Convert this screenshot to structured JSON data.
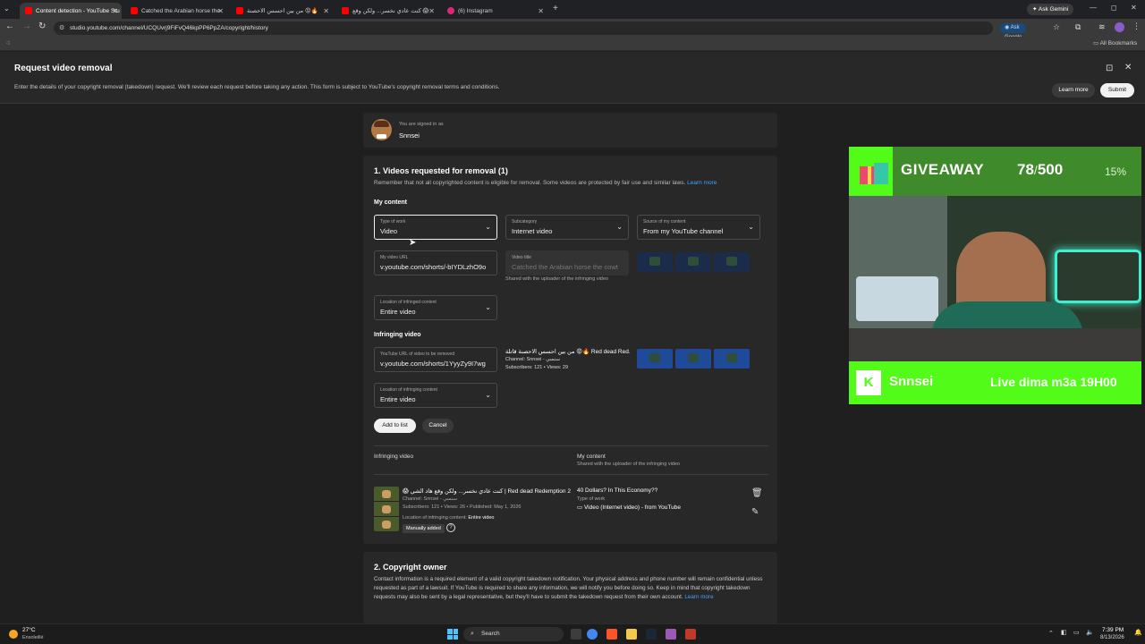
{
  "browser": {
    "tabs": [
      {
        "label": "Content detection - YouTube Stu",
        "color": "#ff0000"
      },
      {
        "label": "Catched the Arabian horse the",
        "color": "#ff0000"
      },
      {
        "label": "من بين احسس الاحصنة 😡🔥",
        "color": "#ff0000"
      },
      {
        "label": "كنت عادي نخسر... ولكن وقع 😱",
        "color": "#ff0000"
      },
      {
        "label": "(6) Instagram",
        "color": "#d62976"
      }
    ],
    "new_tab": "+",
    "ask_gemini": "Ask Gemini",
    "url": "studio.youtube.com/channel/UCQUvrj9FiFvQ46kpPP6PpZA/copyright/history",
    "ask_google": "Ask Google",
    "all_bookmarks": "All Bookmarks"
  },
  "header": {
    "title": "Request video removal",
    "description": "Enter the details of your copyright removal (takedown) request. We'll review each request before taking any action. This form is subject to YouTube's copyright removal terms and conditions.",
    "learn_more": "Learn more",
    "submit": "Submit"
  },
  "signed_in": {
    "label": "You are signed in as",
    "name": "Snnsei"
  },
  "section1": {
    "title": "1. Videos requested for removal (1)",
    "note": "Remember that not all copyrighted content is eligible for removal. Some videos are protected by fair use and similar laws.",
    "learn_more": "Learn more",
    "my_content": "My content",
    "type_of_work": {
      "label": "Type of work",
      "value": "Video"
    },
    "subcategory": {
      "label": "Subcategory",
      "value": "Internet video"
    },
    "source": {
      "label": "Source of my content",
      "value": "From my YouTube channel"
    },
    "my_video_url": {
      "label": "My video URL",
      "value": "v.youtube.com/shorts/-bIYDLzhO9o"
    },
    "video_title": {
      "label": "Video title",
      "value": "Catched the Arabian horse the cowt"
    },
    "shared_note": "Shared with the uploader of the infringing video",
    "location_infringed": {
      "label": "Location of infringed content",
      "value": "Entire video"
    },
    "infringing_video": "Infringing video",
    "yt_url": {
      "label": "YouTube URL of video to be removed",
      "value": "v.youtube.com/shorts/1YyyZy9I7wg"
    },
    "infr_title": "من بين احسس الاحصنة قاتلة 😡🔥 Red dead Red...",
    "infr_channel": "Channel: Snnsei - سنسي",
    "infr_stats": "Subscribers: 121 • Views: 29",
    "location_infringing": {
      "label": "Location of infringing content",
      "value": "Entire video"
    },
    "add_to_list": "Add to list",
    "cancel": "Cancel",
    "list_head_infr": "Infringing video",
    "list_head_my": "My content",
    "list_head_my_sub": "Shared with the uploader of the infringing video",
    "row": {
      "title": "😱 كنت عادي نخسر... ولكن وقع هاد الشي | Red dead Redemption 2",
      "channel": "Channel: Snnsei - سنسي",
      "stats": "Subscribers: 121 • Views: 26 • Published: May 1, 2026",
      "location_label": "Location of infringing content:",
      "location_value": "Entire video",
      "badge": "Manually added",
      "my_title": "40 Dollars? In This Economy??",
      "my_type_label": "Type of work",
      "my_type_value": "Video (Internet video) - from YouTube"
    }
  },
  "section2": {
    "title": "2. Copyright owner",
    "text": "Contact information is a required element of a valid copyright takedown notification. Your physical address and phone number will remain confidential unless requested as part of a lawsuit. If YouTube is required to share any information, we will notify you before doing so. Keep in mind that copyright takedown requests may also be sent by a legal representative, but they'll have to submit the takedown request from their own account.",
    "learn_more": "Learn more"
  },
  "overlay": {
    "giveaway": "GIVEAWAY",
    "count_current": "78",
    "count_sep": "/",
    "count_total": "500",
    "percent": "15%",
    "progress": 0.15,
    "streamer": "Snnsei",
    "schedule": "Live dima m3a 19H00",
    "kick_letter": "K",
    "accent": "#53fc18"
  },
  "taskbar": {
    "weather_temp": "27°C",
    "weather_desc": "Ensoleillé",
    "search": "Search",
    "time": "7:39 PM",
    "date": "8/13/2026"
  }
}
